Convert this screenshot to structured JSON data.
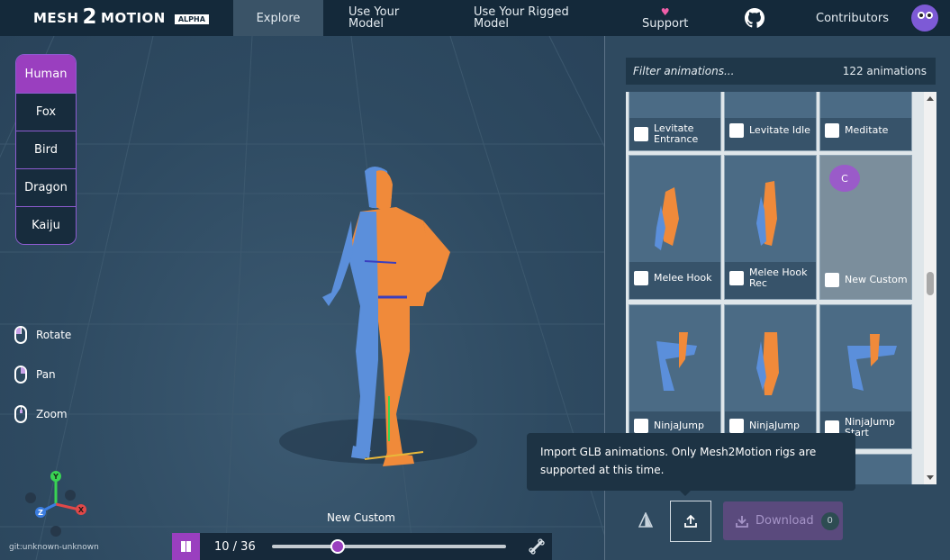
{
  "app": {
    "logo_mesh": "MESH",
    "logo_two": "2",
    "logo_motion": "MOTION",
    "logo_badge": "ALPHA"
  },
  "nav": {
    "explore": "Explore",
    "upload_line1": "Use Your",
    "upload_line2": "Model",
    "rigged_line1": "Use Your Rigged",
    "rigged_line2": "Model",
    "support": "Support",
    "contributors": "Contributors"
  },
  "skeletons": [
    "Human",
    "Fox",
    "Bird",
    "Dragon",
    "Kaiju"
  ],
  "controls": {
    "rotate": "Rotate",
    "pan": "Pan",
    "zoom": "Zoom"
  },
  "gizmo": {
    "x": "X",
    "y": "Y",
    "z": "Z"
  },
  "viewport": {
    "animation_name": "New Custom",
    "version": "git:unknown-unknown"
  },
  "playback": {
    "frame_display": "10 / 36",
    "progress": 0.28
  },
  "panel": {
    "filter_placeholder": "Filter animations...",
    "count": "122 animations",
    "custom_badge": "C",
    "animations": [
      {
        "label_line1": "Levitate",
        "label_line2": "Entrance"
      },
      {
        "label_line1": "Levitate Idle",
        "label_line2": ""
      },
      {
        "label_line1": "Meditate",
        "label_line2": ""
      },
      {
        "label_line1": "Melee Hook",
        "label_line2": ""
      },
      {
        "label_line1": "Melee Hook",
        "label_line2": "Rec"
      },
      {
        "label_line1": "New Custom",
        "label_line2": ""
      },
      {
        "label_line1": "NinjaJump",
        "label_line2": ""
      },
      {
        "label_line1": "NinjaJump",
        "label_line2": ""
      },
      {
        "label_line1": "NinjaJump",
        "label_line2": "Start"
      }
    ]
  },
  "tooltip": {
    "text": "Import GLB animations. Only Mesh2Motion rigs are supported at this time."
  },
  "footer": {
    "download_label": "Download",
    "download_count": "0"
  },
  "colors": {
    "accent": "#9a3fbf",
    "topbar": "#14293a",
    "viewport": "#2f4a60",
    "model_orange": "#f08a3a",
    "model_blue": "#5b8fdb"
  }
}
